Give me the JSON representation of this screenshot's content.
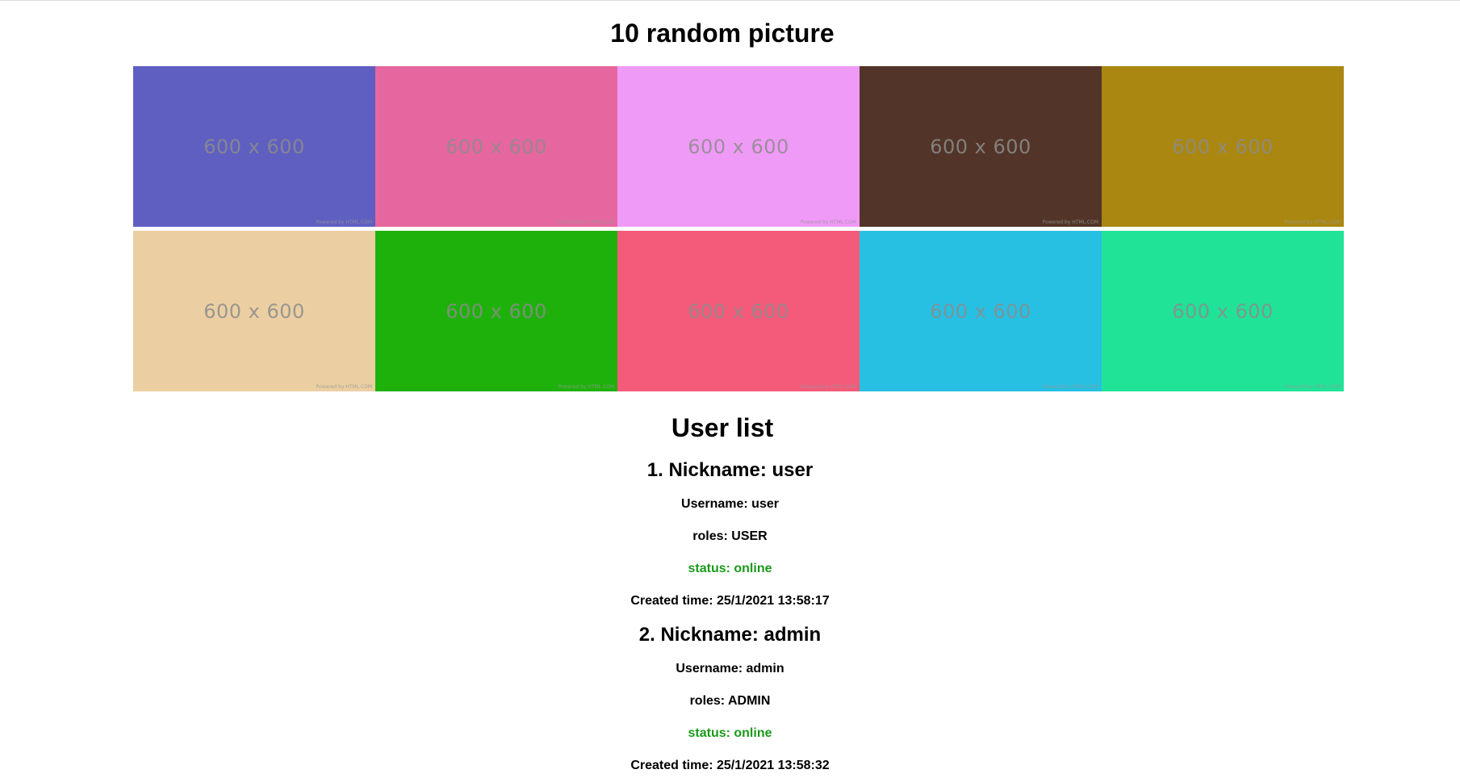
{
  "page": {
    "title": "10 random picture"
  },
  "gallery": {
    "tiles": [
      {
        "label": "600 x 600",
        "credit": "Powered by HTML.COM",
        "color": "#5f5fc1"
      },
      {
        "label": "600 x 600",
        "credit": "Powered by HTML.COM",
        "color": "#e6679f"
      },
      {
        "label": "600 x 600",
        "credit": "Powered by HTML.COM",
        "color": "#f09af7"
      },
      {
        "label": "600 x 600",
        "credit": "Powered by HTML.COM",
        "color": "#523528"
      },
      {
        "label": "600 x 600",
        "credit": "Powered by HTML.COM",
        "color": "#aa8710"
      },
      {
        "label": "600 x 600",
        "credit": "Powered by HTML.COM",
        "color": "#ebcfa2"
      },
      {
        "label": "600 x 600",
        "credit": "Powered by HTML.COM",
        "color": "#1fb10b"
      },
      {
        "label": "600 x 600",
        "credit": "Powered by HTML.COM",
        "color": "#f45b7a"
      },
      {
        "label": "600 x 600",
        "credit": "Powered by HTML.COM",
        "color": "#27c0e3"
      },
      {
        "label": "600 x 600",
        "credit": "Powered by HTML.COM",
        "color": "#20e398"
      }
    ]
  },
  "users": {
    "title": "User list",
    "status_color": "#1a9a1a",
    "items": [
      {
        "heading": "1. Nickname: user",
        "username": "Username: user",
        "roles": "roles: USER",
        "status": "status: online",
        "created": "Created time: 25/1/2021 13:58:17"
      },
      {
        "heading": "2. Nickname: admin",
        "username": "Username: admin",
        "roles": "roles: ADMIN",
        "status": "status: online",
        "created": "Created time: 25/1/2021 13:58:32"
      }
    ]
  }
}
